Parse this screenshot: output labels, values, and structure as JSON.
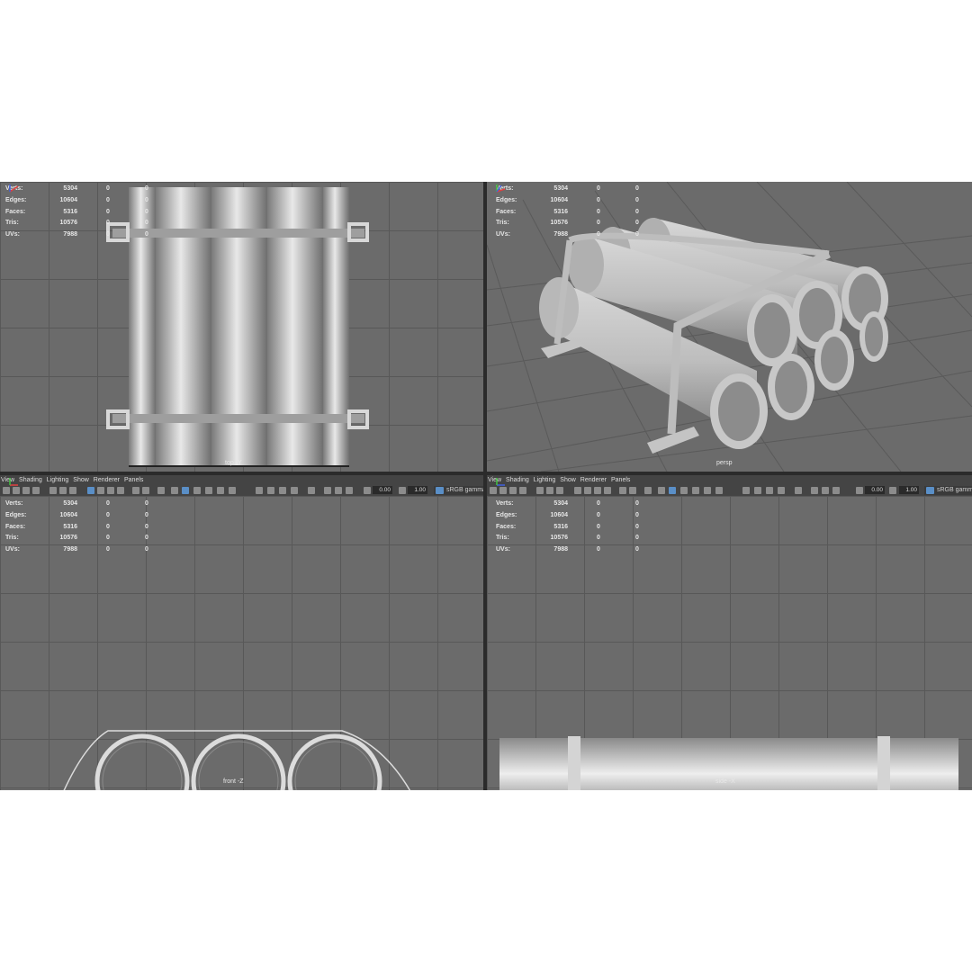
{
  "hud": {
    "rows": [
      {
        "label": "Verts:",
        "v1": "5304",
        "v2": "0",
        "v3": "0"
      },
      {
        "label": "Edges:",
        "v1": "10604",
        "v2": "0",
        "v3": "0"
      },
      {
        "label": "Faces:",
        "v1": "5316",
        "v2": "0",
        "v3": "0"
      },
      {
        "label": "Tris:",
        "v1": "10576",
        "v2": "0",
        "v3": "0"
      },
      {
        "label": "UVs:",
        "v1": "7988",
        "v2": "0",
        "v3": "0"
      }
    ]
  },
  "viewports": {
    "top": {
      "camera": "top -Y"
    },
    "persp": {
      "camera": "persp"
    },
    "front": {
      "camera": "front -Z"
    },
    "side": {
      "camera": "side -X"
    }
  },
  "panel_menu": [
    "View",
    "Shading",
    "Lighting",
    "Show",
    "Renderer",
    "Panels"
  ],
  "toolbar": {
    "exposure": "0.00",
    "gamma": "1.00",
    "color_space": "sRGB gamma"
  },
  "colors": {
    "viewport_bg": "#6b6b6b",
    "grid_line": "#585858",
    "mesh": "#b8b8b8",
    "toolbar_bg": "#444444"
  }
}
